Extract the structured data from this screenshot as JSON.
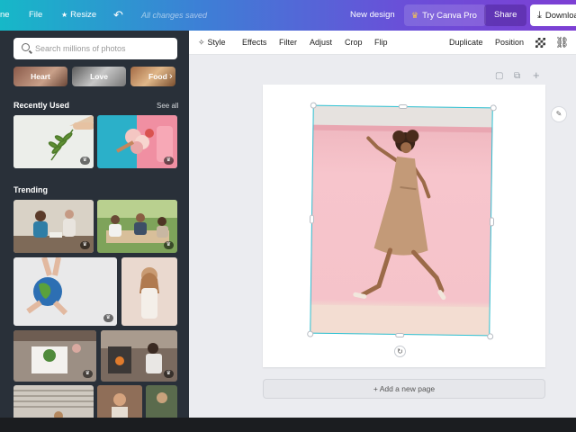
{
  "topbar": {
    "home_label": "ne",
    "file_label": "File",
    "resize_label": "Resize",
    "undo_icon": "undo-icon",
    "saved_status": "All changes saved",
    "new_design_label": "New design",
    "try_pro_label": "Try Canva Pro",
    "share_label": "Share",
    "download_label": "Download"
  },
  "panel": {
    "search_placeholder": "Search millions of photos",
    "chips": [
      {
        "label": "Heart"
      },
      {
        "label": "Love"
      },
      {
        "label": "Food"
      }
    ],
    "recently_used": {
      "title": "Recently Used",
      "see_all": "See all",
      "badges": [
        "♛",
        "♛"
      ]
    },
    "trending": {
      "title": "Trending",
      "badges": [
        "♛",
        "♛",
        "♛",
        "♛",
        "♛",
        "♛"
      ]
    }
  },
  "toolbar": {
    "style_label": "Style",
    "effects_label": "Effects",
    "filter_label": "Filter",
    "adjust_label": "Adjust",
    "crop_label": "Crop",
    "flip_label": "Flip",
    "duplicate_label": "Duplicate",
    "position_label": "Position"
  },
  "canvas": {
    "add_page_label": "+ Add a new page"
  },
  "colors": {
    "topbar_gradient": [
      "#16b8c8",
      "#3d7fd6",
      "#6a4fd8",
      "#7d3fd4"
    ],
    "panel_bg": "#293039",
    "canvas_bg": "#ebecf0",
    "selection": "#2ec2d4",
    "photo_pink": "#f7c5cc"
  }
}
